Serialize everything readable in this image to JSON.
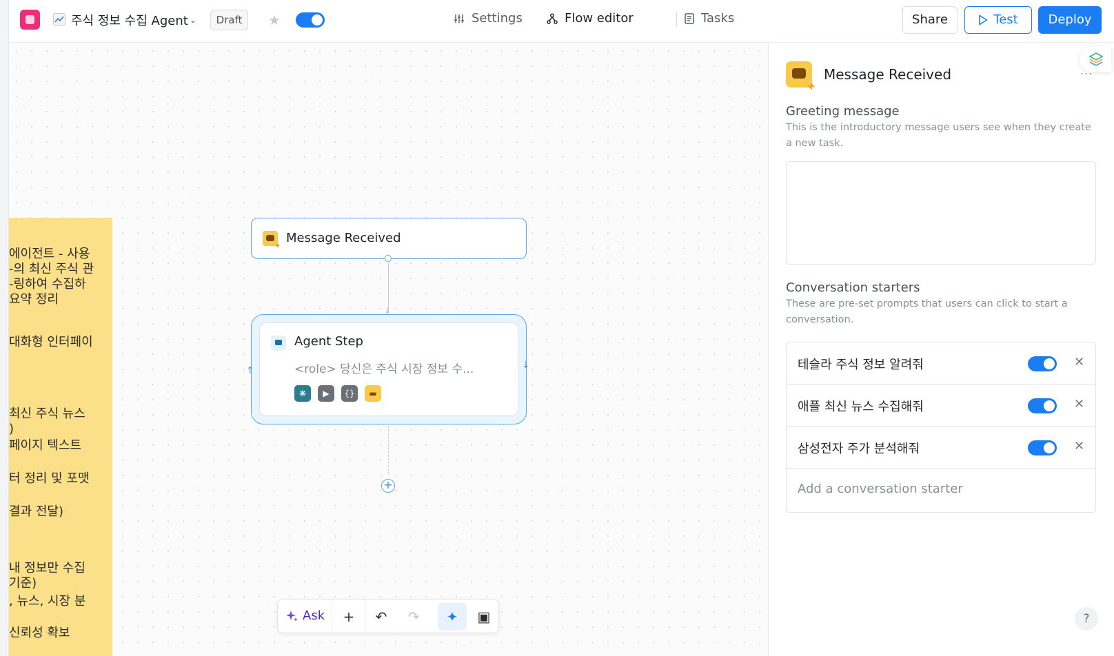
{
  "header": {
    "agent_name": "주식 정보 수집 Agent",
    "status_badge": "Draft",
    "nav": {
      "settings": "Settings",
      "flow_editor": "Flow editor",
      "tasks": "Tasks"
    },
    "share_label": "Share",
    "test_label": "Test",
    "deploy_label": "Deploy",
    "active_tab": "Flow editor",
    "agent_enabled": true
  },
  "sticky_note": {
    "lines": [
      "에이전트 - 사용",
      "-의 최신 주식 관",
      "-링하여 수집하",
      "요약 정리",
      "대화형 인터페이",
      "최신 주식 뉴스",
      ")",
      "페이지 텍스트",
      "터 정리 및 포맷",
      "결과 전달)",
      "내 정보만 수집",
      "기준)",
      ", 뉴스, 시장 분",
      "신뢰성 확보"
    ]
  },
  "flow": {
    "trigger_node": {
      "label": "Message Received"
    },
    "agent_node": {
      "title": "Agent Step",
      "description": "<role> 당신은 주식 시장 정보 수..."
    }
  },
  "toolbar": {
    "ask_label": "Ask"
  },
  "panel": {
    "title": "Message Received",
    "more": "...",
    "greeting": {
      "label": "Greeting message",
      "description": "This is the introductory message users see when they create a new task.",
      "value": ""
    },
    "starters": {
      "label": "Conversation starters",
      "description": "These are pre-set prompts that users can click to start a conversation.",
      "items": [
        {
          "text": "테슬라 주식 정보 알려줘",
          "enabled": true
        },
        {
          "text": "애플 최신 뉴스 수집해줘",
          "enabled": true
        },
        {
          "text": "삼성전자 주가 분석해줘",
          "enabled": true
        }
      ],
      "add_placeholder": "Add a conversation starter"
    },
    "help": "?"
  },
  "colors": {
    "accent": "#1a7ef2",
    "sticky": "#fbe089",
    "node_border": "#5ba6e8"
  }
}
